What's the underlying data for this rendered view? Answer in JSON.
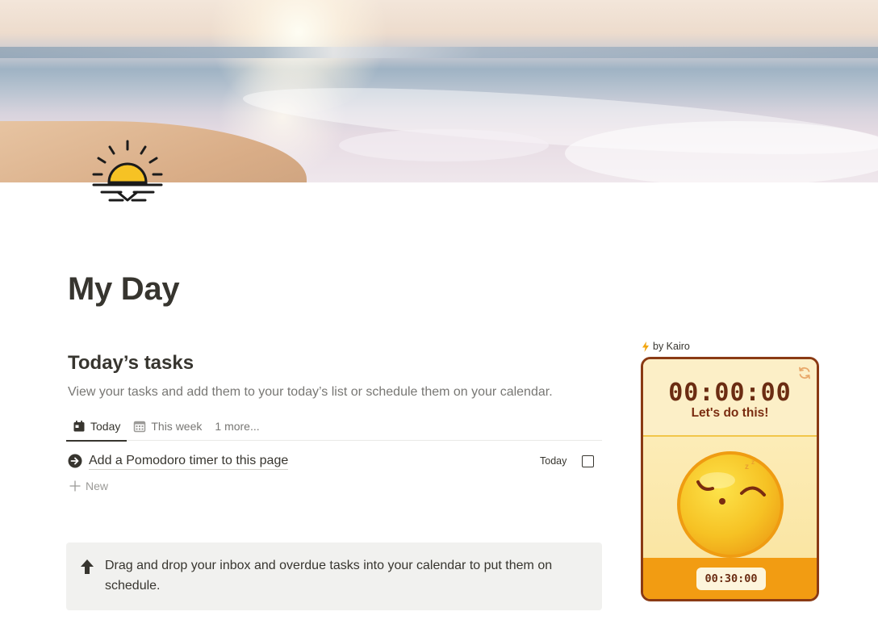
{
  "page": {
    "title": "My Day"
  },
  "section": {
    "heading": "Today’s tasks",
    "description": "View your tasks and add them to your today’s list or schedule them on your calendar."
  },
  "tabs": [
    {
      "label": "Today",
      "icon": "calendar-icon",
      "active": true
    },
    {
      "label": "This week",
      "icon": "calendar-grid-icon",
      "active": false
    },
    {
      "label": "1 more...",
      "active": false
    }
  ],
  "tasks": [
    {
      "name": "Add a Pomodoro timer to this page",
      "due": "Today",
      "done": false,
      "icon": "arrow-circle-icon"
    }
  ],
  "new_label": "New",
  "callout": {
    "icon": "arrow-up-icon",
    "text": "Drag and drop your inbox and overdue tasks into your calendar to put them on schedule."
  },
  "widget": {
    "credit": "by Kairo",
    "timer": "00:00:00",
    "motto": "Let's do this!",
    "duration": "00:30:00",
    "colors": {
      "border": "#8a3a14",
      "face": "#f6c224",
      "footer": "#f29c12",
      "text": "#6b2c12"
    }
  }
}
